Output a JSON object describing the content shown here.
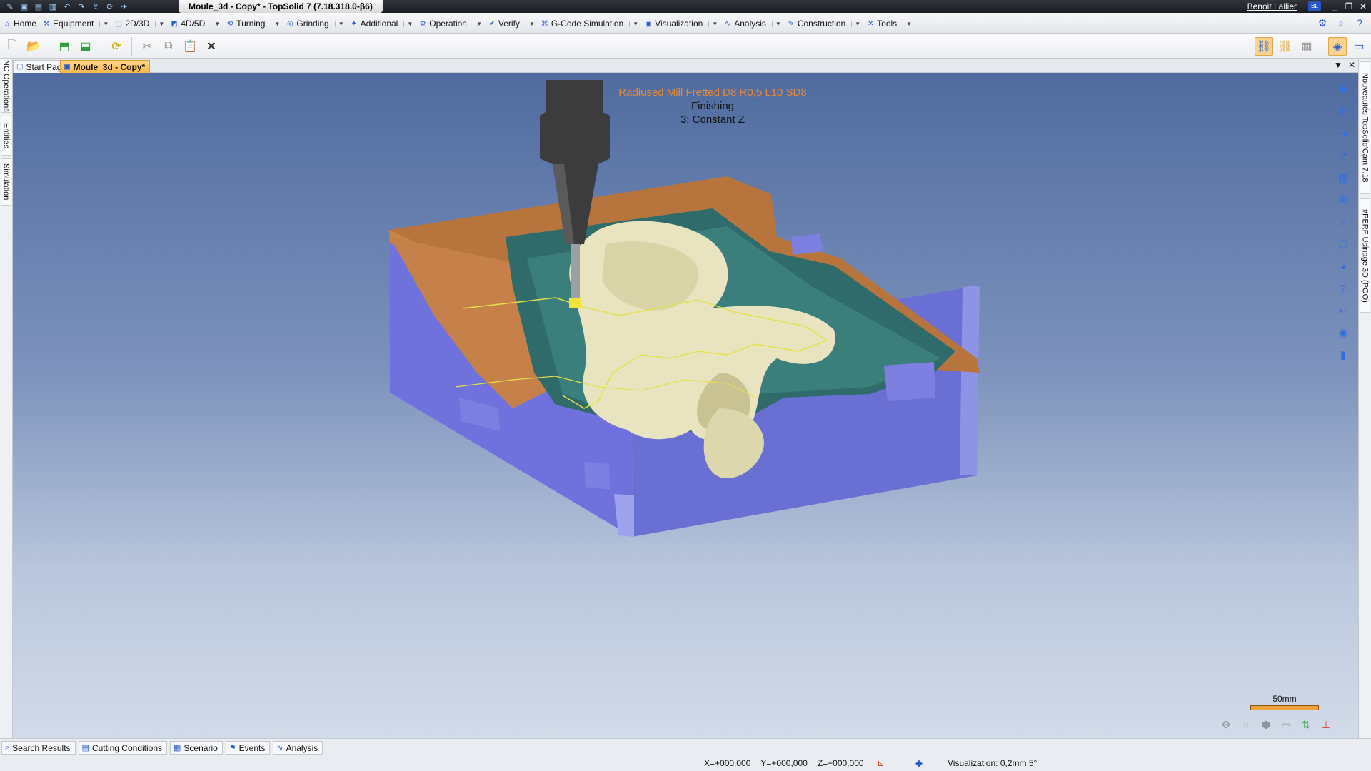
{
  "window": {
    "title": "Moule_3d - Copy* - TopSolid 7 (7.18.318.0-β6)",
    "user": "Benoit Lallier",
    "user_badge": "BL"
  },
  "menu": {
    "items": [
      {
        "label": "Home",
        "icon": "home-icon"
      },
      {
        "label": "Equipment",
        "icon": "equipment-icon"
      },
      {
        "label": "2D/3D",
        "icon": "2d3d-icon"
      },
      {
        "label": "4D/5D",
        "icon": "4d5d-icon"
      },
      {
        "label": "Turning",
        "icon": "turning-icon"
      },
      {
        "label": "Grinding",
        "icon": "grinding-icon"
      },
      {
        "label": "Additional",
        "icon": "additional-icon"
      },
      {
        "label": "Operation",
        "icon": "operation-icon"
      },
      {
        "label": "Verify",
        "icon": "verify-icon"
      },
      {
        "label": "G-Code Simulation",
        "icon": "gcode-icon"
      },
      {
        "label": "Visualization",
        "icon": "visualization-icon"
      },
      {
        "label": "Analysis",
        "icon": "analysis-icon"
      },
      {
        "label": "Construction",
        "icon": "construction-icon"
      },
      {
        "label": "Tools",
        "icon": "tools-icon"
      }
    ]
  },
  "left_panels": [
    "NC Operations",
    "Entities",
    "Simulation"
  ],
  "right_panels": [
    "Nouveautés TopSolid'Cam 7.18",
    "#PERF Usinage 3D (POO)"
  ],
  "doc_tabs": [
    {
      "label": "Start Page",
      "active": false
    },
    {
      "label": "Moule_3d - Copy*",
      "active": true
    }
  ],
  "viewport": {
    "tool_name": "Radiused Mill Fretted D8 R0,5 L10 SD8",
    "operation": "Finishing",
    "step": "3: Constant Z",
    "scale_label": "50mm"
  },
  "bottom_tabs": [
    {
      "label": "Search Results",
      "icon": "search-results-icon"
    },
    {
      "label": "Cutting Conditions",
      "icon": "cutting-conditions-icon"
    },
    {
      "label": "Scenario",
      "icon": "scenario-icon"
    },
    {
      "label": "Events",
      "icon": "events-icon"
    },
    {
      "label": "Analysis",
      "icon": "analysis-icon"
    }
  ],
  "status": {
    "x": "X=+000,000",
    "y": "Y=+000,000",
    "z": "Z=+000,000",
    "visualization": "Visualization: 0,2mm 5°"
  },
  "colors": {
    "block_side": "#6b6fd8",
    "block_top": "#b8743d",
    "cavity": "#2f6b6a",
    "part_surface": "#e8e4bf",
    "toolpath": "#e6e048",
    "accent": "#f6b84a"
  }
}
